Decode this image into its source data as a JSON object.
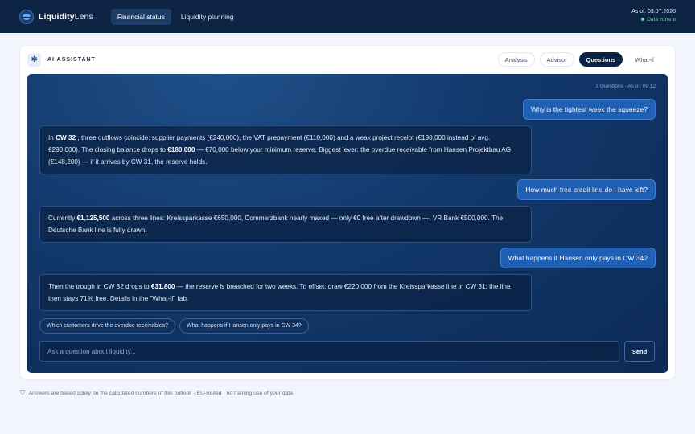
{
  "app": {
    "logo_bold": "Liquidity",
    "logo_light": "Lens",
    "nav": [
      {
        "label": "Financial status",
        "active": true
      },
      {
        "label": "Liquidity planning",
        "active": false
      }
    ],
    "as_of": "As of: 03.07.2026",
    "data_status": "Data current"
  },
  "card": {
    "title": "AI ASSISTANT",
    "icon": "sparkle-icon",
    "tabs": [
      {
        "label": "Analysis",
        "active": false
      },
      {
        "label": "Advisor",
        "active": false
      },
      {
        "label": "Questions",
        "active": true
      },
      {
        "label": "What-if",
        "active": false
      }
    ]
  },
  "chat": {
    "meta": "3 Questions · As of: 09:12",
    "messages": [
      {
        "role": "user",
        "text": "Why is the tightest week the squeeze?"
      },
      {
        "role": "assistant",
        "parts": [
          {
            "t": "In "
          },
          {
            "t": "CW 32",
            "b": true
          },
          {
            "t": " , three outflows coincide: supplier payments (€240,000), the VAT prepayment (€110,000) and a weak project receipt (€190,000 instead of avg. €290,000). The closing balance drops to "
          },
          {
            "t": "€180,000",
            "b": true
          },
          {
            "t": " — €70,000 below your minimum reserve. Biggest lever: the overdue receivable from Hansen Projektbau AG (€148,200) — if it arrives by CW 31, the reserve holds."
          }
        ]
      },
      {
        "role": "user",
        "text": "How much free credit line do I have left?"
      },
      {
        "role": "assistant",
        "parts": [
          {
            "t": "Currently "
          },
          {
            "t": "€1,125,500",
            "b": true
          },
          {
            "t": " across three lines: Kreissparkasse €650,000, Commerzbank nearly maxed — only €0 free after drawdown —, VR Bank €500,000. The Deutsche Bank line is fully drawn."
          }
        ]
      },
      {
        "role": "user",
        "text": "What happens if Hansen only pays in CW 34?"
      },
      {
        "role": "assistant",
        "parts": [
          {
            "t": "Then the trough in CW 32 drops to "
          },
          {
            "t": "€31,800",
            "b": true
          },
          {
            "t": " — the reserve is breached for two weeks. To offset: draw €220,000 from the Kreissparkasse line in CW 31; the line then stays 71% free. Details in the \"What-if\" tab."
          }
        ]
      }
    ],
    "suggestions": [
      "Which customers drive the overdue receivables?",
      "What happens if Hansen only pays in CW 34?"
    ],
    "input_placeholder": "Ask a question about liquidity...",
    "send_label": "Send"
  },
  "footer": {
    "text": "Answers are based solely on the calculated numbers of this outlook · EU-routed · no training use of your data",
    "icon": "shield-icon"
  }
}
